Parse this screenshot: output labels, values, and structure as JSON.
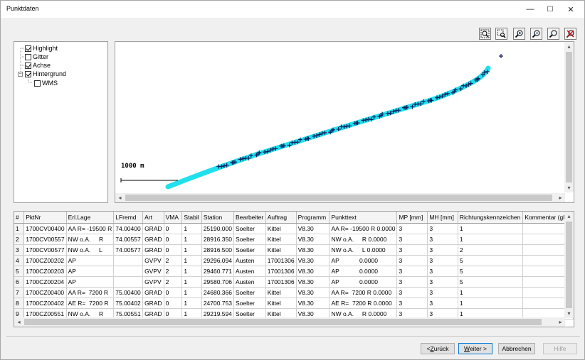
{
  "window": {
    "title": "Punktdaten",
    "minimize": "—",
    "maximize": "☐",
    "close": "✕"
  },
  "toolbar": {
    "tools": [
      {
        "name": "zoom-extents-icon"
      },
      {
        "name": "zoom-window-icon"
      },
      {
        "name": "zoom-in-icon"
      },
      {
        "name": "zoom-out-icon"
      },
      {
        "name": "zoom-previous-icon"
      },
      {
        "name": "cancel-icon"
      }
    ]
  },
  "layers": [
    {
      "label": "Highlight",
      "checked": true
    },
    {
      "label": "Gitter",
      "checked": false
    },
    {
      "label": "Achse",
      "checked": true
    },
    {
      "label": "Hintergrund",
      "checked": true
    },
    {
      "label": "WMS",
      "checked": false
    }
  ],
  "map": {
    "scale_label": "1000 m",
    "axis_color": "#20e0ee",
    "marker_color": "#102060"
  },
  "table": {
    "columns": [
      "#",
      "PktNr",
      "Erl.Lage",
      "LFremd",
      "Art",
      "VMA",
      "Stabil",
      "Station",
      "Bearbeiter",
      "Auftrag",
      "Programm",
      "Punkttext",
      "MP [mm]",
      "MH [mm]",
      "Richtungskennzeichen",
      "Kommentar (gl-s"
    ],
    "rows": [
      [
        "1",
        "1700CV00400",
        "AA R= -19500 R",
        "74.00400",
        "GRAD",
        "0",
        "1",
        "25190.000",
        "Soelter",
        "Kittel",
        "V8.30",
        "AA R= -19500 R 0.0000",
        "3",
        "3",
        "1",
        ""
      ],
      [
        "2",
        "1700CV00557",
        "NW o.A.     R",
        "74.00557",
        "GRAD",
        "0",
        "1",
        "28916.350",
        "Soelter",
        "Kittel",
        "V8.30",
        "NW o.A.     R 0.0000",
        "3",
        "3",
        "1",
        ""
      ],
      [
        "3",
        "1700CV00577",
        "NW o.A.     L",
        "74.00577",
        "GRAD",
        "0",
        "1",
        "28916.500",
        "Soelter",
        "Kittel",
        "V8.30",
        "NW o.A.     L 0.0000",
        "3",
        "3",
        "2",
        ""
      ],
      [
        "4",
        "1700CZ00202",
        "AP",
        "",
        "GVPV",
        "2",
        "1",
        "29296.094",
        "Austen",
        "17001306",
        "V8.30",
        "AP            0.0000",
        "3",
        "3",
        "5",
        ""
      ],
      [
        "5",
        "1700CZ00203",
        "AP",
        "",
        "GVPV",
        "2",
        "1",
        "29460.771",
        "Austen",
        "17001306",
        "V8.30",
        "AP            0.0000",
        "3",
        "3",
        "5",
        ""
      ],
      [
        "6",
        "1700CZ00204",
        "AP",
        "",
        "GVPV",
        "2",
        "1",
        "29580.706",
        "Austen",
        "17001306",
        "V8.30",
        "AP            0.0000",
        "3",
        "3",
        "5",
        ""
      ],
      [
        "7",
        "1700CZ00400",
        "AA R=  7200 R",
        "75.00400",
        "GRAD",
        "0",
        "1",
        "24680.366",
        "Soelter",
        "Kittel",
        "V8.30",
        "AA R=  7200 R 0.0000",
        "3",
        "3",
        "1",
        ""
      ],
      [
        "8",
        "1700CZ00402",
        "AE R=  7200 R",
        "75.00402",
        "GRAD",
        "0",
        "1",
        "24700.753",
        "Soelter",
        "Kittel",
        "V8.30",
        "AE R=  7200 R 0.0000",
        "3",
        "3",
        "1",
        ""
      ],
      [
        "9",
        "1700CZ00551",
        "NW o.A.     R",
        "75.00551",
        "GRAD",
        "0",
        "1",
        "29219.594",
        "Soelter",
        "Kittel",
        "V8.30",
        "NW o.A.     R 0.0000",
        "3",
        "3",
        "1",
        ""
      ]
    ]
  },
  "buttons": {
    "back": {
      "pre": "< ",
      "key": "Z",
      "post": "urück"
    },
    "next": {
      "pre": "",
      "key": "W",
      "post": "eiter >"
    },
    "cancel": "Abbrechen",
    "help": "Hilfe"
  }
}
